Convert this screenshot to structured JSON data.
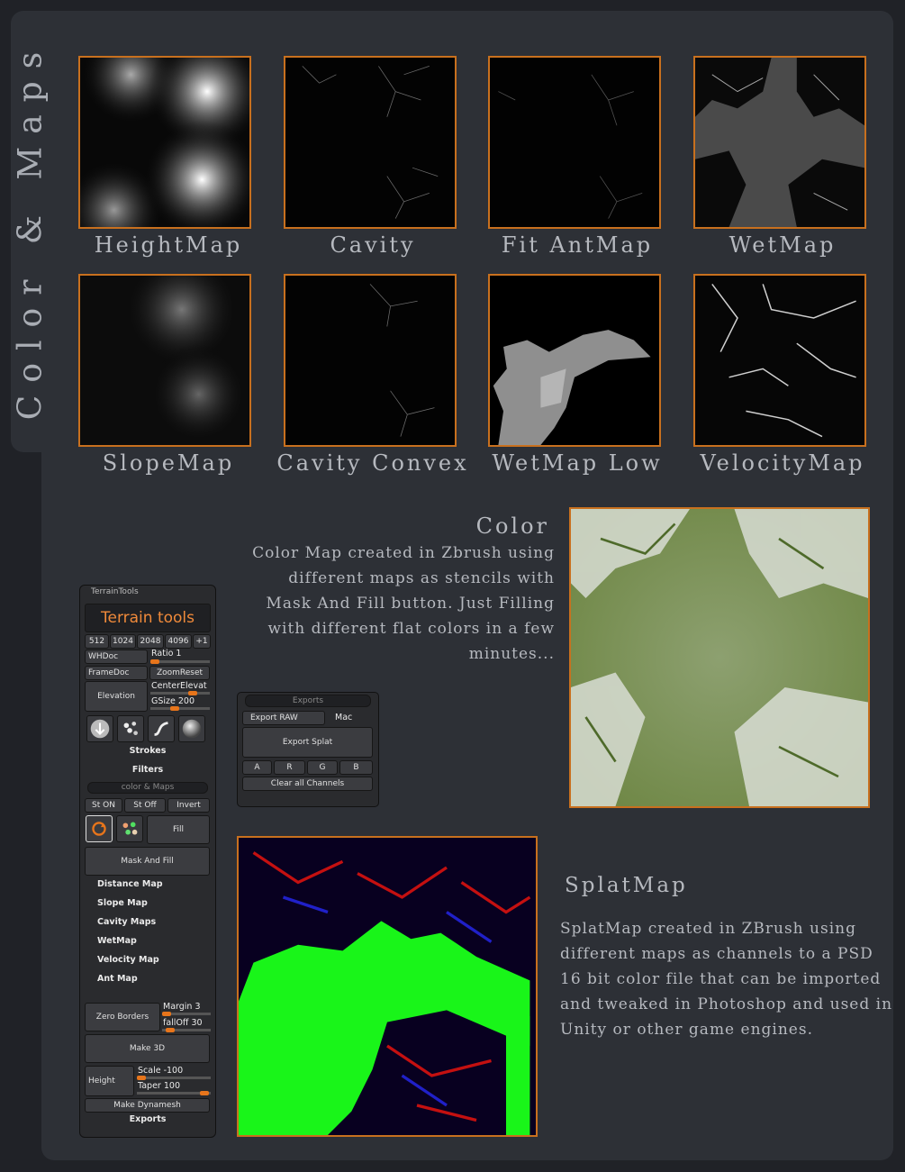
{
  "side_title": "Color & Maps",
  "thumbnails": [
    {
      "label": "HeightMap"
    },
    {
      "label": "Cavity"
    },
    {
      "label": "Fit AntMap"
    },
    {
      "label": "WetMap"
    },
    {
      "label": "SlopeMap"
    },
    {
      "label": "Cavity Convex"
    },
    {
      "label": "WetMap Low"
    },
    {
      "label": "VelocityMap"
    }
  ],
  "color_section": {
    "title": "Color",
    "description": "Color Map created in Zbrush using different maps as stencils with Mask And Fill button. Just Filling with different flat colors in a few minutes..."
  },
  "splat_section": {
    "title": "SplatMap",
    "description": "SplatMap created in ZBrush using different maps as channels to a PSD 16 bit color file that can be imported and tweaked in Photoshop and used in Unity or other game engines."
  },
  "terrain_panel": {
    "header": "TerrainTools",
    "title_button": "Terrain tools",
    "sizes": [
      "512",
      "1024",
      "2048",
      "4096",
      "+1"
    ],
    "whdoc": "WHDoc",
    "ratio": "Ratio 1",
    "framedoc": "FrameDoc",
    "zoomreset": "ZoomReset",
    "elevation": "Elevation",
    "centerelevat": "CenterElevat",
    "gsize": "GSize 200",
    "strokes": "Strokes",
    "filters": "Filters",
    "color_maps_header": "color & Maps",
    "st_on": "St ON",
    "st_off": "St Off",
    "invert": "Invert",
    "fill": "Fill",
    "mask_and_fill": "Mask And Fill",
    "map_items": [
      "Distance Map",
      "Slope Map",
      "Cavity Maps",
      "WetMap",
      "Velocity Map",
      "Ant Map"
    ],
    "zero_borders": "Zero Borders",
    "margin": "Margin 3",
    "falloff": "fallOff 30",
    "make_3d": "Make 3D",
    "height": "Height",
    "scale": "Scale -100",
    "taper": "Taper 100",
    "make_dynamesh": "Make Dynamesh",
    "exports": "Exports"
  },
  "exports_panel": {
    "header": "Exports",
    "export_raw": "Export RAW",
    "mac": "Mac",
    "export_splat": "Export Splat",
    "channels": [
      "A",
      "R",
      "G",
      "B"
    ],
    "clear_all": "Clear all Channels"
  },
  "colors": {
    "accent_orange": "#c8701e",
    "slider_orange": "#e7751b",
    "panel_bg": "#2d3036",
    "page_bg": "#202227"
  }
}
